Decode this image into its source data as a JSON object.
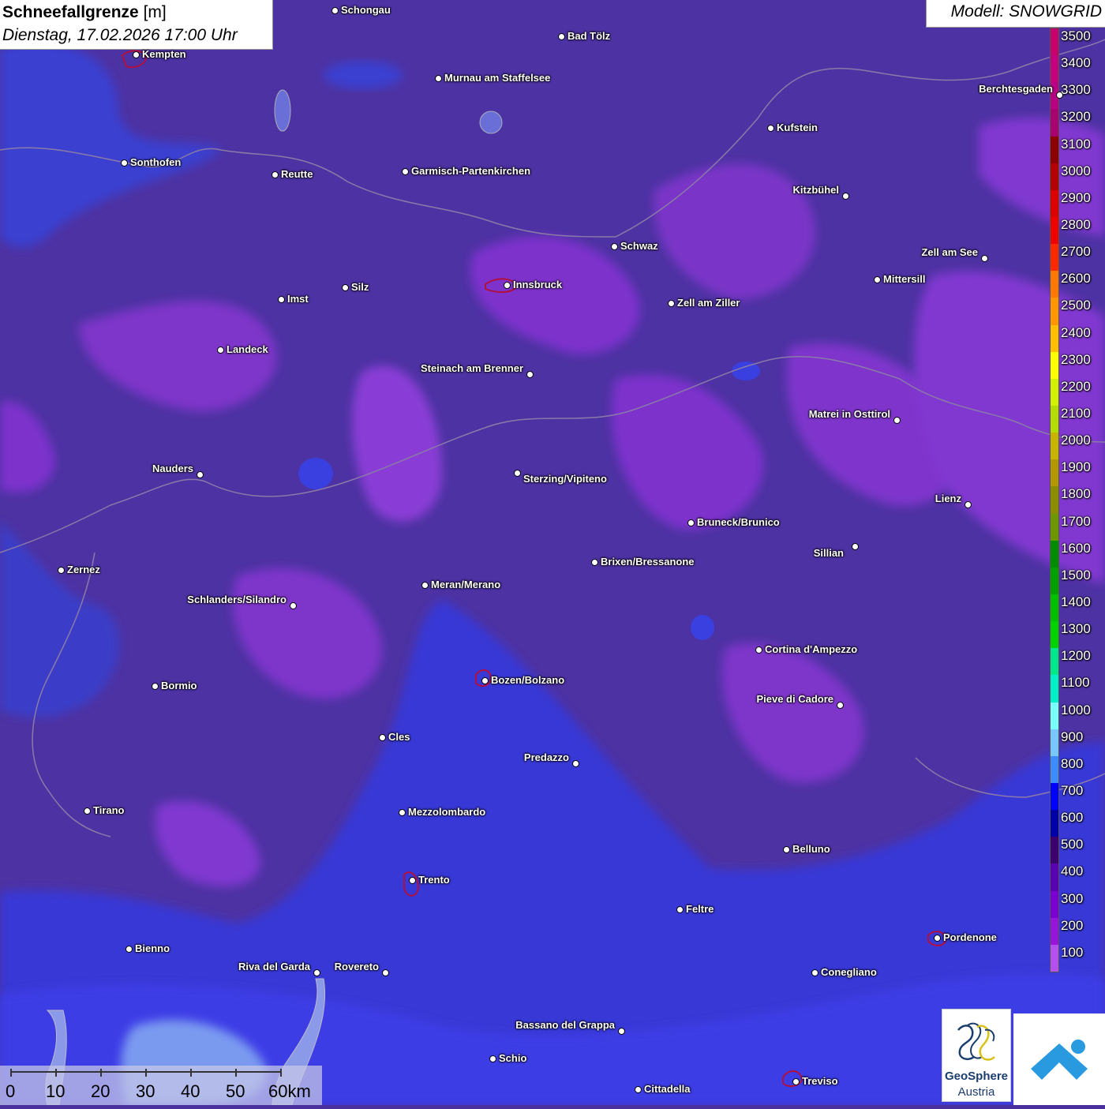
{
  "header": {
    "title_bold": "Schneefallgrenze",
    "title_unit": " [m]",
    "subtitle": "Dienstag, 17.02.2026 17:00 Uhr",
    "model": "Modell: SNOWGRID"
  },
  "legend": {
    "labels": [
      "3500",
      "3400",
      "3300",
      "3200",
      "3100",
      "3000",
      "2900",
      "2800",
      "2700",
      "2600",
      "2500",
      "2400",
      "2300",
      "2200",
      "2100",
      "2000",
      "1900",
      "1800",
      "1700",
      "1600",
      "1500",
      "1400",
      "1300",
      "1200",
      "1100",
      "1000",
      "900",
      "800",
      "700",
      "600",
      "500",
      "400",
      "300",
      "200",
      "100"
    ],
    "colors": [
      "#c8006e",
      "#c4007e",
      "#b80084",
      "#a80070",
      "#8c0000",
      "#b40000",
      "#dc0000",
      "#f00000",
      "#ff2800",
      "#ff7800",
      "#ff9600",
      "#ffbe00",
      "#ffff00",
      "#d2f000",
      "#b4dc00",
      "#c8b400",
      "#b49600",
      "#8c8c00",
      "#6e9600",
      "#008c00",
      "#00a000",
      "#00be00",
      "#00d200",
      "#00e68c",
      "#00f0c8",
      "#78ffff",
      "#78c8ff",
      "#3c8cff",
      "#0000ff",
      "#0000aa",
      "#3c006e",
      "#5a00b4",
      "#7800d2",
      "#9614dc",
      "#b450f0"
    ]
  },
  "cities": [
    {
      "name": "Schongau"
    },
    {
      "name": "Bad Tölz"
    },
    {
      "name": "Kempten"
    },
    {
      "name": "Murnau am Staffelsee"
    },
    {
      "name": "Berchtesgaden"
    },
    {
      "name": "Kufstein"
    },
    {
      "name": "Sonthofen"
    },
    {
      "name": "Reutte"
    },
    {
      "name": "Garmisch-Partenkirchen"
    },
    {
      "name": "Kitzbühel"
    },
    {
      "name": "Schwaz"
    },
    {
      "name": "Zell am See"
    },
    {
      "name": "Innsbruck"
    },
    {
      "name": "Mittersill"
    },
    {
      "name": "Imst"
    },
    {
      "name": "Silz"
    },
    {
      "name": "Zell am Ziller"
    },
    {
      "name": "Landeck"
    },
    {
      "name": "Steinach am Brenner"
    },
    {
      "name": "Matrei in Osttirol"
    },
    {
      "name": "Nauders"
    },
    {
      "name": "Sterzing/Vipiteno"
    },
    {
      "name": "Lienz"
    },
    {
      "name": "Bruneck/Brunico"
    },
    {
      "name": "Sillian"
    },
    {
      "name": "Zernez"
    },
    {
      "name": "Brixen/Bressanone"
    },
    {
      "name": "Meran/Merano"
    },
    {
      "name": "Schlanders/Silandro"
    },
    {
      "name": "Cortina d'Ampezzo"
    },
    {
      "name": "Bozen/Bolzano"
    },
    {
      "name": "Bormio"
    },
    {
      "name": "Pieve di Cadore"
    },
    {
      "name": "Cles"
    },
    {
      "name": "Predazzo"
    },
    {
      "name": "Tirano"
    },
    {
      "name": "Mezzolombardo"
    },
    {
      "name": "Belluno"
    },
    {
      "name": "Trento"
    },
    {
      "name": "Feltre"
    },
    {
      "name": "Pordenone"
    },
    {
      "name": "Bienno"
    },
    {
      "name": "Riva del Garda"
    },
    {
      "name": "Rovereto"
    },
    {
      "name": "Conegliano"
    },
    {
      "name": "Bassano del Grappa"
    },
    {
      "name": "Schio"
    },
    {
      "name": "Treviso"
    },
    {
      "name": "Cittadella"
    }
  ],
  "scale": {
    "labels": [
      "0",
      "10",
      "20",
      "30",
      "40",
      "50",
      "60km"
    ]
  },
  "logo": {
    "line1": "GeoSphere",
    "line2": "Austria"
  }
}
